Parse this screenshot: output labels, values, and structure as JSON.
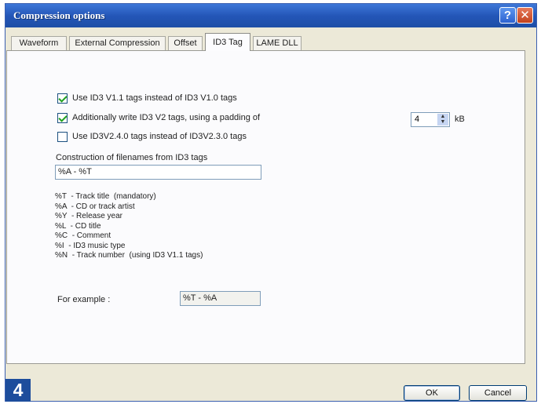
{
  "window": {
    "title": "Compression options"
  },
  "tabs": [
    {
      "label": "Waveform"
    },
    {
      "label": "External Compression"
    },
    {
      "label": "Offset"
    },
    {
      "label": "ID3 Tag"
    },
    {
      "label": "LAME DLL"
    }
  ],
  "active_tab": "ID3 Tag",
  "options": {
    "use_v11": {
      "label": "Use ID3 V1.1 tags instead of ID3 V1.0 tags",
      "checked": true
    },
    "write_v2": {
      "label": "Additionally write ID3 V2 tags, using a padding of",
      "checked": true
    },
    "use_v24": {
      "label": "Use ID3V2.4.0 tags instead of ID3V2.3.0 tags",
      "checked": false
    }
  },
  "padding": {
    "value": "4",
    "unit": "kB"
  },
  "filename": {
    "label": "Construction of filenames from ID3 tags",
    "value": "%A - %T"
  },
  "legend": [
    {
      "code": "%T",
      "desc": "- Track title  (mandatory)"
    },
    {
      "code": "%A",
      "desc": "- CD or track artist"
    },
    {
      "code": "%Y",
      "desc": "- Release year"
    },
    {
      "code": "%L",
      "desc": "- CD title"
    },
    {
      "code": "%C",
      "desc": "- Comment"
    },
    {
      "code": "%I",
      "desc": "- ID3 music type"
    },
    {
      "code": "%N",
      "desc": "- Track number  (using ID3 V1.1 tags)"
    }
  ],
  "example": {
    "label": "For example :",
    "value": "%T - %A"
  },
  "buttons": {
    "ok": "OK",
    "cancel": "Cancel",
    "help": "?",
    "close": "✕"
  },
  "step_badge": "4"
}
